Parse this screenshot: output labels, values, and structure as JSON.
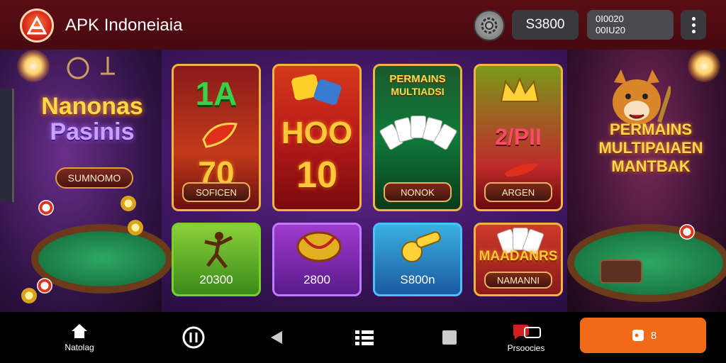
{
  "header": {
    "app_title": "APK Indoneiaia",
    "coin_value": "S3800",
    "info_line1": "0I0020",
    "info_line2": "00IU20"
  },
  "left_banner": {
    "title_line1": "Nanonas",
    "title_line2": "Pasinis",
    "button": "SUMNOMO"
  },
  "right_banner": {
    "title_line1": "PERMAINS",
    "title_line2": "MULTIPAIAEN",
    "title_line3": "MANTBAK"
  },
  "tiles": [
    {
      "art_top": "1A",
      "art_bottom": "70",
      "button": "SOFICEN"
    },
    {
      "art_top": "HOO",
      "art_bottom": "10",
      "button": ""
    },
    {
      "art_top": "PERMAINS",
      "art_bottom": "MULTIADSI",
      "button": "NONOK"
    },
    {
      "art_top": "2/PII",
      "art_bottom": "",
      "button": "ARGEN"
    },
    {
      "label": "20300"
    },
    {
      "label": "2800"
    },
    {
      "label": "S800n"
    },
    {
      "art_top": "MAADANRS",
      "button": "NAMANNI"
    }
  ],
  "nav": {
    "home_label": "Natolag",
    "promo_label": "Prsoocies",
    "cta_label": "8"
  },
  "icons": {
    "logo": "app-logo",
    "settings": "gear-icon",
    "menu": "more-vertical-icon",
    "home": "home-icon",
    "recent": "recent-icon",
    "back": "back-icon",
    "list": "list-icon",
    "square": "square-icon",
    "promo": "chat-badge-icon",
    "cta": "game-controller-icon"
  },
  "colors": {
    "header_bg": "#5a0c14",
    "accent_gold": "#f0b440",
    "cta_orange": "#f06a18",
    "nav_bg": "#000000"
  }
}
